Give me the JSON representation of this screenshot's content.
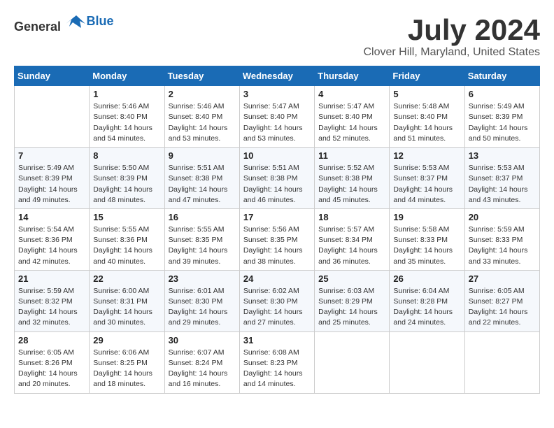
{
  "header": {
    "logo_general": "General",
    "logo_blue": "Blue",
    "title": "July 2024",
    "subtitle": "Clover Hill, Maryland, United States"
  },
  "days_of_week": [
    "Sunday",
    "Monday",
    "Tuesday",
    "Wednesday",
    "Thursday",
    "Friday",
    "Saturday"
  ],
  "weeks": [
    [
      {
        "day": "",
        "info": ""
      },
      {
        "day": "1",
        "info": "Sunrise: 5:46 AM\nSunset: 8:40 PM\nDaylight: 14 hours\nand 54 minutes."
      },
      {
        "day": "2",
        "info": "Sunrise: 5:46 AM\nSunset: 8:40 PM\nDaylight: 14 hours\nand 53 minutes."
      },
      {
        "day": "3",
        "info": "Sunrise: 5:47 AM\nSunset: 8:40 PM\nDaylight: 14 hours\nand 53 minutes."
      },
      {
        "day": "4",
        "info": "Sunrise: 5:47 AM\nSunset: 8:40 PM\nDaylight: 14 hours\nand 52 minutes."
      },
      {
        "day": "5",
        "info": "Sunrise: 5:48 AM\nSunset: 8:40 PM\nDaylight: 14 hours\nand 51 minutes."
      },
      {
        "day": "6",
        "info": "Sunrise: 5:49 AM\nSunset: 8:39 PM\nDaylight: 14 hours\nand 50 minutes."
      }
    ],
    [
      {
        "day": "7",
        "info": "Sunrise: 5:49 AM\nSunset: 8:39 PM\nDaylight: 14 hours\nand 49 minutes."
      },
      {
        "day": "8",
        "info": "Sunrise: 5:50 AM\nSunset: 8:39 PM\nDaylight: 14 hours\nand 48 minutes."
      },
      {
        "day": "9",
        "info": "Sunrise: 5:51 AM\nSunset: 8:38 PM\nDaylight: 14 hours\nand 47 minutes."
      },
      {
        "day": "10",
        "info": "Sunrise: 5:51 AM\nSunset: 8:38 PM\nDaylight: 14 hours\nand 46 minutes."
      },
      {
        "day": "11",
        "info": "Sunrise: 5:52 AM\nSunset: 8:38 PM\nDaylight: 14 hours\nand 45 minutes."
      },
      {
        "day": "12",
        "info": "Sunrise: 5:53 AM\nSunset: 8:37 PM\nDaylight: 14 hours\nand 44 minutes."
      },
      {
        "day": "13",
        "info": "Sunrise: 5:53 AM\nSunset: 8:37 PM\nDaylight: 14 hours\nand 43 minutes."
      }
    ],
    [
      {
        "day": "14",
        "info": "Sunrise: 5:54 AM\nSunset: 8:36 PM\nDaylight: 14 hours\nand 42 minutes."
      },
      {
        "day": "15",
        "info": "Sunrise: 5:55 AM\nSunset: 8:36 PM\nDaylight: 14 hours\nand 40 minutes."
      },
      {
        "day": "16",
        "info": "Sunrise: 5:55 AM\nSunset: 8:35 PM\nDaylight: 14 hours\nand 39 minutes."
      },
      {
        "day": "17",
        "info": "Sunrise: 5:56 AM\nSunset: 8:35 PM\nDaylight: 14 hours\nand 38 minutes."
      },
      {
        "day": "18",
        "info": "Sunrise: 5:57 AM\nSunset: 8:34 PM\nDaylight: 14 hours\nand 36 minutes."
      },
      {
        "day": "19",
        "info": "Sunrise: 5:58 AM\nSunset: 8:33 PM\nDaylight: 14 hours\nand 35 minutes."
      },
      {
        "day": "20",
        "info": "Sunrise: 5:59 AM\nSunset: 8:33 PM\nDaylight: 14 hours\nand 33 minutes."
      }
    ],
    [
      {
        "day": "21",
        "info": "Sunrise: 5:59 AM\nSunset: 8:32 PM\nDaylight: 14 hours\nand 32 minutes."
      },
      {
        "day": "22",
        "info": "Sunrise: 6:00 AM\nSunset: 8:31 PM\nDaylight: 14 hours\nand 30 minutes."
      },
      {
        "day": "23",
        "info": "Sunrise: 6:01 AM\nSunset: 8:30 PM\nDaylight: 14 hours\nand 29 minutes."
      },
      {
        "day": "24",
        "info": "Sunrise: 6:02 AM\nSunset: 8:30 PM\nDaylight: 14 hours\nand 27 minutes."
      },
      {
        "day": "25",
        "info": "Sunrise: 6:03 AM\nSunset: 8:29 PM\nDaylight: 14 hours\nand 25 minutes."
      },
      {
        "day": "26",
        "info": "Sunrise: 6:04 AM\nSunset: 8:28 PM\nDaylight: 14 hours\nand 24 minutes."
      },
      {
        "day": "27",
        "info": "Sunrise: 6:05 AM\nSunset: 8:27 PM\nDaylight: 14 hours\nand 22 minutes."
      }
    ],
    [
      {
        "day": "28",
        "info": "Sunrise: 6:05 AM\nSunset: 8:26 PM\nDaylight: 14 hours\nand 20 minutes."
      },
      {
        "day": "29",
        "info": "Sunrise: 6:06 AM\nSunset: 8:25 PM\nDaylight: 14 hours\nand 18 minutes."
      },
      {
        "day": "30",
        "info": "Sunrise: 6:07 AM\nSunset: 8:24 PM\nDaylight: 14 hours\nand 16 minutes."
      },
      {
        "day": "31",
        "info": "Sunrise: 6:08 AM\nSunset: 8:23 PM\nDaylight: 14 hours\nand 14 minutes."
      },
      {
        "day": "",
        "info": ""
      },
      {
        "day": "",
        "info": ""
      },
      {
        "day": "",
        "info": ""
      }
    ]
  ]
}
